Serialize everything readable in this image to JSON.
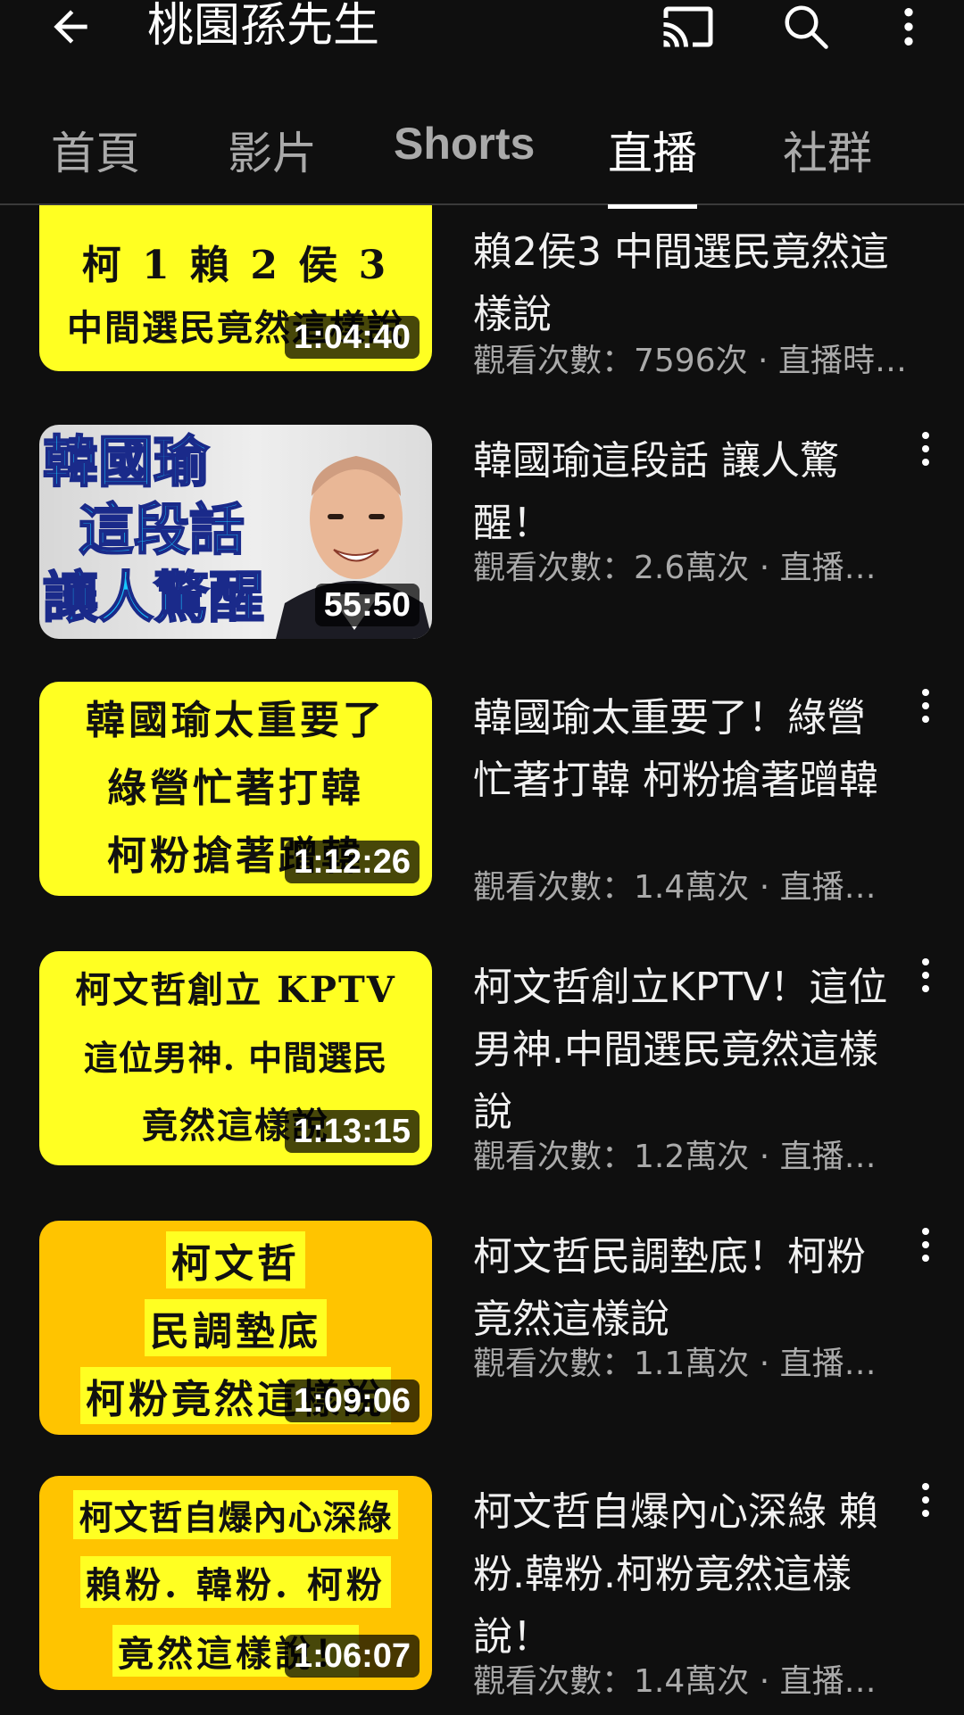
{
  "header": {
    "channel_name": "桃園孫先生",
    "back_icon": "arrow-back-icon",
    "cast_icon": "cast-icon",
    "search_icon": "search-icon",
    "more_icon": "more-vert-icon"
  },
  "tabs": [
    {
      "label": "首頁",
      "active": false
    },
    {
      "label": "影片",
      "active": false
    },
    {
      "label": "Shorts",
      "active": false
    },
    {
      "label": "直播",
      "active": true
    },
    {
      "label": "社群",
      "active": false
    }
  ],
  "videos": [
    {
      "thumb_lines": [
        "柯 1 賴 2 侯 3",
        "中間選民竟然這樣說"
      ],
      "duration": "1:04:40",
      "title": "賴2侯3 中間選民竟然這樣說",
      "meta": "觀看次數：7596次 · 直播時…"
    },
    {
      "thumb_lines": [
        "韓國瑜",
        "這段話",
        "讓人驚醒"
      ],
      "duration": "55:50",
      "title": "韓國瑜這段話 讓人驚醒！",
      "meta": "觀看次數：2.6萬次 · 直播…"
    },
    {
      "thumb_lines": [
        "韓國瑜太重要了",
        "綠營忙著打韓",
        "柯粉搶著蹭韓"
      ],
      "duration": "1:12:26",
      "title": "韓國瑜太重要了！綠營忙著打韓 柯粉搶著蹭韓",
      "meta": "觀看次數：1.4萬次 · 直播…"
    },
    {
      "thumb_lines": [
        "柯文哲創立 KPTV",
        "這位男神. 中間選民",
        "竟然這樣說"
      ],
      "duration": "1:13:15",
      "title": "柯文哲創立KPTV！這位男神.中間選民竟然這樣說",
      "meta": "觀看次數：1.2萬次 · 直播…"
    },
    {
      "thumb_lines": [
        "柯文哲",
        "民調墊底",
        "柯粉竟然這樣說"
      ],
      "duration": "1:09:06",
      "title": "柯文哲民調墊底！柯粉竟然這樣說",
      "meta": "觀看次數：1.1萬次 · 直播…"
    },
    {
      "thumb_lines": [
        "柯文哲自爆內心深綠",
        "賴粉. 韓粉. 柯粉",
        "竟然這樣說！"
      ],
      "duration": "1:06:07",
      "title": "柯文哲自爆內心深綠 賴粉.韓粉.柯粉竟然這樣說！",
      "meta": "觀看次數：1.4萬次 · 直播…"
    }
  ]
}
